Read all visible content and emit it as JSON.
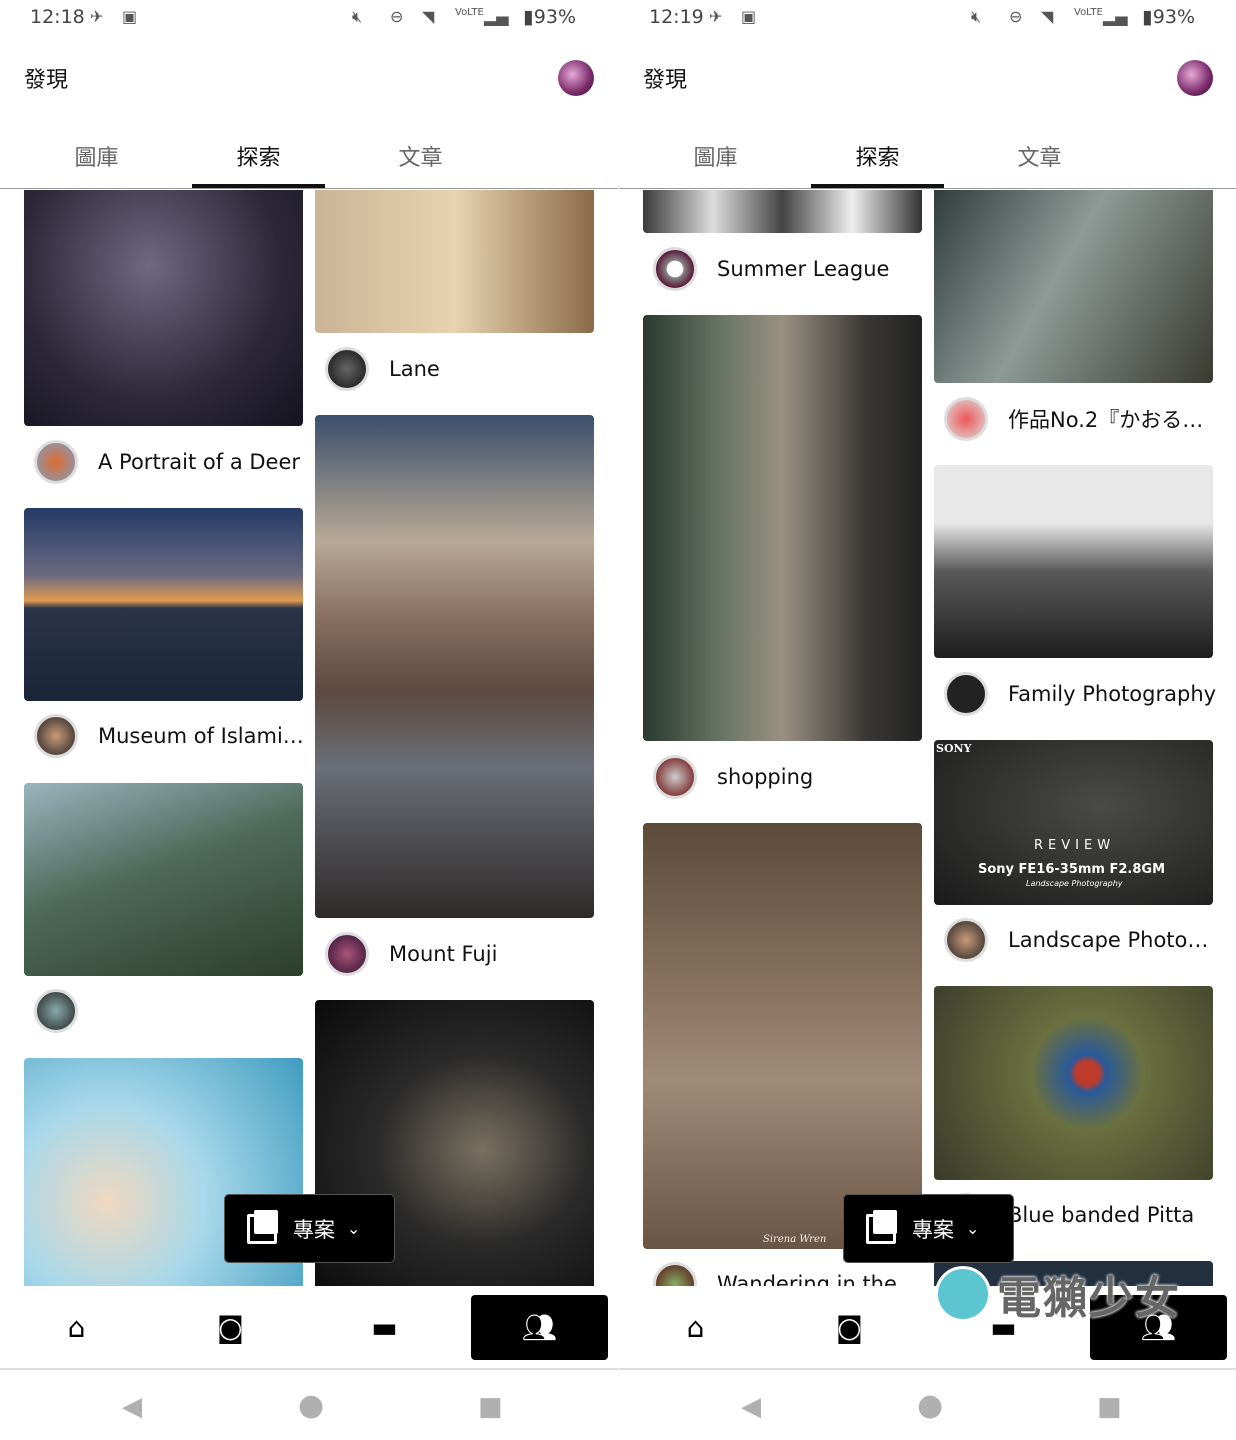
{
  "screens": [
    {
      "status": {
        "time": "12:18",
        "battery": "93%"
      },
      "header": {
        "title": "發現"
      },
      "tabs": [
        {
          "label": "圖庫"
        },
        {
          "label": "探索",
          "active": true
        },
        {
          "label": "文章"
        }
      ],
      "cards": [
        {
          "title": "A Portrait of a Deer"
        },
        {
          "title": "Museum of Islami…"
        },
        {
          "title": ""
        },
        {
          "title": ""
        },
        {
          "title": "Lane"
        },
        {
          "title": "Mount Fuji"
        },
        {
          "title": ""
        }
      ],
      "fab": {
        "label": "專案",
        "icon": "gallery-icon"
      },
      "bottom_nav": [
        {
          "icon": "home-icon"
        },
        {
          "icon": "camera-icon"
        },
        {
          "icon": "folder-icon"
        },
        {
          "icon": "people-icon",
          "active": true
        }
      ]
    },
    {
      "status": {
        "time": "12:19",
        "battery": "93%"
      },
      "header": {
        "title": "發現"
      },
      "tabs": [
        {
          "label": "圖庫"
        },
        {
          "label": "探索",
          "active": true
        },
        {
          "label": "文章"
        }
      ],
      "cards": [
        {
          "title": "Summer League"
        },
        {
          "title": "shopping"
        },
        {
          "title": "Wandering in the …"
        },
        {
          "title": "作品No.2『かおる…"
        },
        {
          "title": "Family Photography"
        },
        {
          "title": "Landscape Photog…"
        },
        {
          "title": "Blue banded Pitta"
        }
      ],
      "image_text": {
        "sony_brand": "SONY",
        "review": "REVIEW",
        "lens": "Sony FE16-35mm F2.8GM",
        "sub": "Landscape Photography",
        "signature": "Sirena Wren"
      },
      "fab": {
        "label": "專案",
        "icon": "gallery-icon"
      },
      "bottom_nav": [
        {
          "icon": "home-icon"
        },
        {
          "icon": "camera-icon"
        },
        {
          "icon": "folder-icon"
        },
        {
          "icon": "people-icon",
          "active": true
        }
      ]
    }
  ],
  "watermark": "電獺少女",
  "colors": {
    "accent": "#000000",
    "tab_inactive": "#666666",
    "sys_nav": "#b0b0b0"
  }
}
